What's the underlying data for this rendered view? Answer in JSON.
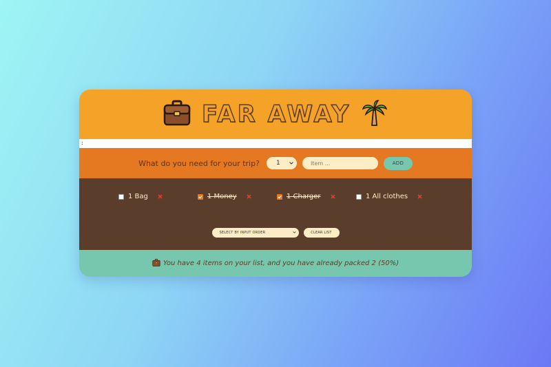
{
  "header": {
    "title": "FAR AWAY",
    "left_icon": "briefcase-icon",
    "right_icon": "palm-tree-icon"
  },
  "strip": {
    "mark": ":"
  },
  "form": {
    "prompt": "What do you need for your trip?",
    "quantity_value": "1",
    "item_placeholder": "Item ...",
    "add_label": "ADD"
  },
  "items": [
    {
      "quantity": "1",
      "description": "Bag",
      "text": "1 Bag",
      "packed": false
    },
    {
      "quantity": "1",
      "description": "Money",
      "text": "1 Money",
      "packed": true
    },
    {
      "quantity": "1",
      "description": "Charger",
      "text": "1 Charger",
      "packed": true
    },
    {
      "quantity": "1",
      "description": "All clothes",
      "text": "1 All clothes",
      "packed": false
    }
  ],
  "actions": {
    "sort_value": "SELECT BY INPUT ORDER",
    "clear_label": "CLEAR LIST"
  },
  "stats": {
    "icon": "briefcase-icon",
    "text": "You have 4 items on your list, and you have already packed 2 (50%)"
  },
  "colors": {
    "header": "#f5a328",
    "form": "#e47921",
    "list": "#5a3e2b",
    "stats": "#76c7ad",
    "input": "#fdedc4",
    "delete": "#e53b2c"
  }
}
